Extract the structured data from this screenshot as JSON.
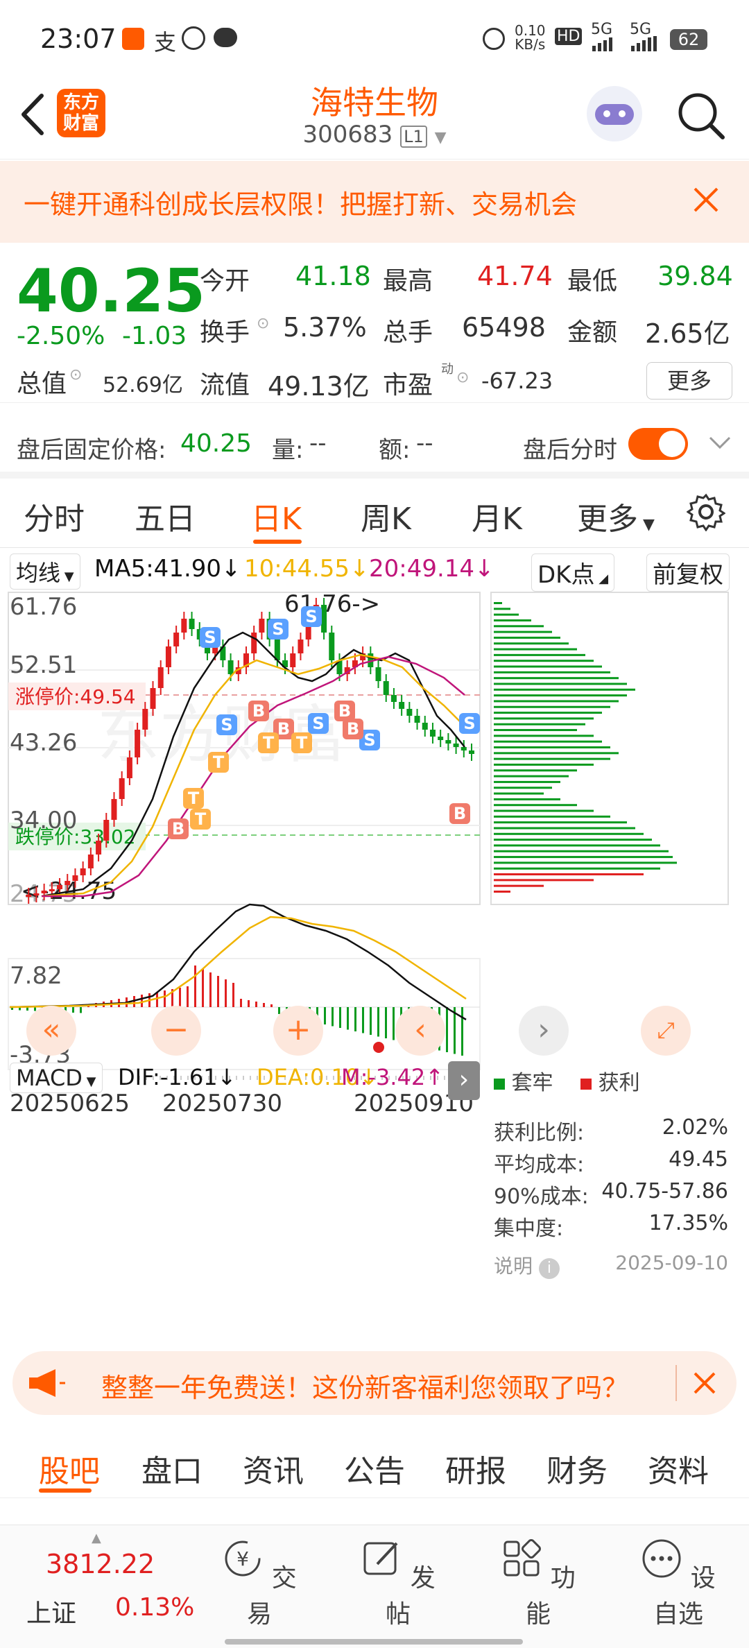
{
  "status": {
    "time": "23:07",
    "net_speed_value": "0.10",
    "net_speed_unit": "KB/s",
    "battery": "62",
    "signal1": "5G",
    "signal2": "5G",
    "hd": "HD"
  },
  "header": {
    "app_logo_line1": "东方",
    "app_logo_line2": "财富",
    "stock_name": "海特生物",
    "stock_code": "300683",
    "level": "L1"
  },
  "banner_top": {
    "text": "一键开通科创成长层权限！把握打新、交易机会"
  },
  "quote": {
    "price": "40.25",
    "change_pct": "-2.50%",
    "change_amt": "-1.03",
    "open_label": "今开",
    "open": "41.18",
    "high_label": "最高",
    "high": "41.74",
    "low_label": "最低",
    "low": "39.84",
    "turnover_label": "换手",
    "turnover": "5.37%",
    "volume_label": "总手",
    "volume": "65498",
    "amount_label": "金额",
    "amount": "2.65亿",
    "mcap_label": "总值",
    "mcap": "52.69亿",
    "float_label": "流值",
    "float_cap": "49.13亿",
    "pe_label": "市盈",
    "pe_sup": "动",
    "pe": "-67.23",
    "more_button": "更多"
  },
  "after_hours": {
    "label": "盘后固定价格:",
    "price": "40.25",
    "vol_label": "量:",
    "vol": "--",
    "amt_label": "额:",
    "amt": "--",
    "toggle_label": "盘后分时",
    "toggle_on": true
  },
  "period_tabs": {
    "items": [
      "分时",
      "五日",
      "日K",
      "周K",
      "月K",
      "更多"
    ],
    "active": "日K"
  },
  "kline": {
    "ma_selector": "均线",
    "ma5": "MA5:41.90",
    "ma10": "10:44.55",
    "ma20": "20:49.14",
    "dk_button": "DK点",
    "adjust_button": "前复权",
    "y_labels": [
      "61.76",
      "52.51",
      "43.26",
      "34.00",
      "24.75"
    ],
    "max_marker": "61.76->",
    "min_marker": "<-24.75",
    "limit_up": "涨停价:49.54",
    "limit_down": "跌停价:33.02",
    "watermark": "东方财富",
    "colors": {
      "ma5": "#111111",
      "ma10": "#f0b400",
      "ma20": "#c0157a",
      "up": "#e02020",
      "down": "#0a9a1e"
    }
  },
  "chips": {
    "legend_trapped": "套牢",
    "legend_profit": "获利",
    "profit_ratio_label": "获利比例:",
    "profit_ratio": "2.02%",
    "avg_cost_label": "平均成本:",
    "avg_cost": "49.45",
    "cost90_label": "90%成本:",
    "cost90": "40.75-57.86",
    "concentration_label": "集中度:",
    "concentration": "17.35%",
    "note_label": "说明",
    "date": "2025-09-10"
  },
  "macd": {
    "selector": "MACD",
    "dif": "DIF:-1.61",
    "dea": "DEA:0.10",
    "m": "M:-3.42",
    "y_top": "7.82",
    "y_bottom": "-3.73",
    "dates": [
      "20250625",
      "20250730",
      "20250910"
    ]
  },
  "banner_bottom": {
    "text": "整整一年免费送！这份新客福利您领取了吗？"
  },
  "sub_tabs": {
    "items": [
      "股吧",
      "盘口",
      "资讯",
      "公告",
      "研报",
      "财务",
      "资料"
    ],
    "active": "股吧"
  },
  "bottom_nav": {
    "index_value": "3812.22",
    "index_name": "上证",
    "index_change": "0.13%",
    "items": [
      "交易",
      "发帖",
      "功能",
      "设自选"
    ]
  }
}
